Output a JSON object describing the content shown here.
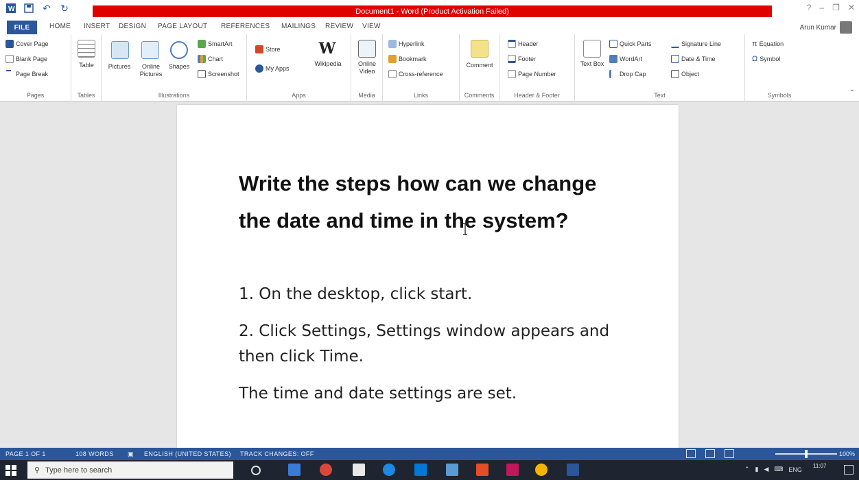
{
  "titlebar": {
    "title": "Document1 - Word (Product Activation Failed)",
    "help": "?",
    "min": "–",
    "restore": "❐",
    "close": "✕"
  },
  "tabs": {
    "file": "FILE",
    "home": "HOME",
    "insert": "INSERT",
    "design": "DESIGN",
    "page_layout": "PAGE LAYOUT",
    "references": "REFERENCES",
    "mailings": "MAILINGS",
    "review": "REVIEW",
    "view": "VIEW",
    "user": "Arun Kumar"
  },
  "ribbon": {
    "pages": {
      "label": "Pages",
      "cover": "Cover Page",
      "blank": "Blank Page",
      "break": "Page Break"
    },
    "tables": {
      "label": "Tables",
      "table": "Table"
    },
    "illustrations": {
      "label": "Illustrations",
      "pictures": "Pictures",
      "online_pictures": "Online Pictures",
      "shapes": "Shapes",
      "smartart": "SmartArt",
      "chart": "Chart",
      "screenshot": "Screenshot"
    },
    "apps": {
      "label": "Apps",
      "store": "Store",
      "myapps": "My Apps",
      "wikipedia": "Wikipedia"
    },
    "media": {
      "label": "Media",
      "online_video": "Online Video"
    },
    "links": {
      "label": "Links",
      "hyperlink": "Hyperlink",
      "bookmark": "Bookmark",
      "crossref": "Cross-reference"
    },
    "comments": {
      "label": "Comments",
      "comment": "Comment"
    },
    "header_footer": {
      "label": "Header & Footer",
      "header": "Header",
      "footer": "Footer",
      "page_number": "Page Number"
    },
    "text": {
      "label": "Text",
      "textbox": "Text Box",
      "quickparts": "Quick Parts",
      "wordart": "WordArt",
      "dropcap": "Drop Cap",
      "signature": "Signature Line",
      "datetime": "Date & Time",
      "object": "Object"
    },
    "symbols": {
      "label": "Symbols",
      "equation": "Equation",
      "symbol": "Symbol"
    }
  },
  "document": {
    "heading": "Write the steps how can we change the date and time in the system?",
    "step1": "1. On the desktop, click start.",
    "step2": "2. Click Settings, Settings window appears and then click Time.",
    "conclusion": "The time and date settings are set."
  },
  "statusbar": {
    "page": "PAGE 1 OF 1",
    "words": "108 WORDS",
    "language": "ENGLISH (UNITED STATES)",
    "track": "TRACK CHANGES: OFF",
    "zoom": "100%"
  },
  "taskbar": {
    "search_placeholder": "Type here to search",
    "lang": "ENG",
    "time": "11:07"
  },
  "colors": {
    "word_blue": "#2b579a",
    "title_red": "#e00000",
    "taskbar": "#1f2530"
  }
}
